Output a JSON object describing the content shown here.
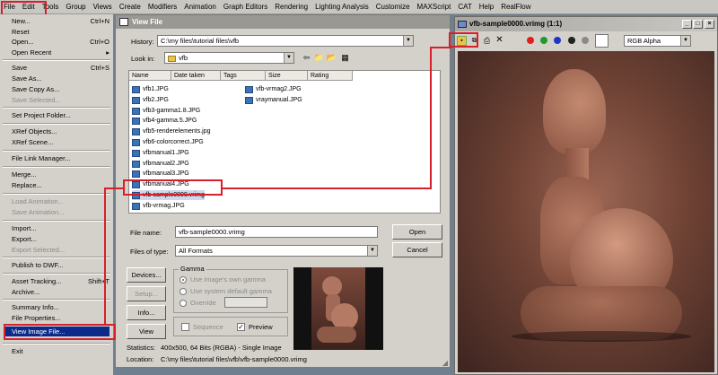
{
  "menubar": {
    "items": [
      "File",
      "Edit",
      "Tools",
      "Group",
      "Views",
      "Create",
      "Modifiers",
      "Animation",
      "Graph Editors",
      "Rendering",
      "Lighting Analysis",
      "Customize",
      "MAXScript",
      "CAT",
      "Help",
      "RealFlow"
    ]
  },
  "file_menu": {
    "items": [
      {
        "label": "New...",
        "shortcut": "Ctrl+N",
        "disabled": false
      },
      {
        "label": "Reset",
        "shortcut": "",
        "disabled": false
      },
      {
        "label": "Open...",
        "shortcut": "Ctrl+O",
        "disabled": false
      },
      {
        "label": "Open Recent",
        "shortcut": "▸",
        "disabled": false
      },
      {
        "label": "Save",
        "shortcut": "Ctrl+S",
        "disabled": false
      },
      {
        "label": "Save As...",
        "shortcut": "",
        "disabled": false
      },
      {
        "label": "Save Copy As...",
        "shortcut": "",
        "disabled": false
      },
      {
        "label": "Save Selected...",
        "shortcut": "",
        "disabled": true
      },
      {
        "label": "Set Project Folder...",
        "shortcut": "",
        "disabled": false
      },
      {
        "label": "XRef Objects...",
        "shortcut": "",
        "disabled": false
      },
      {
        "label": "XRef Scene...",
        "shortcut": "",
        "disabled": false
      },
      {
        "label": "File Link Manager...",
        "shortcut": "",
        "disabled": false
      },
      {
        "label": "Merge...",
        "shortcut": "",
        "disabled": false
      },
      {
        "label": "Replace...",
        "shortcut": "",
        "disabled": false
      },
      {
        "label": "Load Animation...",
        "shortcut": "",
        "disabled": true
      },
      {
        "label": "Save Animation...",
        "shortcut": "",
        "disabled": true
      },
      {
        "label": "Import...",
        "shortcut": "",
        "disabled": false
      },
      {
        "label": "Export...",
        "shortcut": "",
        "disabled": false
      },
      {
        "label": "Export Selected...",
        "shortcut": "",
        "disabled": true
      },
      {
        "label": "Publish to DWF...",
        "shortcut": "",
        "disabled": false
      },
      {
        "label": "Asset Tracking...",
        "shortcut": "Shift+T",
        "disabled": false
      },
      {
        "label": "Archive...",
        "shortcut": "",
        "disabled": false
      },
      {
        "label": "Summary Info...",
        "shortcut": "",
        "disabled": false
      },
      {
        "label": "File Properties...",
        "shortcut": "",
        "disabled": false
      },
      {
        "label": "View Image File...",
        "shortcut": "",
        "disabled": false,
        "selected": true
      },
      {
        "label": "Exit",
        "shortcut": "",
        "disabled": false
      }
    ]
  },
  "dialog": {
    "title": "View File",
    "history_label": "History:",
    "history_value": "C:\\my files\\tutorial files\\vfb",
    "lookin_label": "Look in:",
    "lookin_value": "vfb",
    "columns": [
      "Name",
      "Date taken",
      "Tags",
      "Size",
      "Rating"
    ],
    "files_col1": [
      "vfb1.JPG",
      "vfb2.JPG",
      "vfb3-gamma1.8.JPG",
      "vfb4-gamma.5.JPG",
      "vfb5-renderelements.jpg",
      "vfb6-colorcorrect.JPG",
      "vfbmanual1.JPG",
      "vfbmanual2.JPG",
      "vfbmanual3.JPG",
      "vfbmanual4.JPG",
      "vfb-sample0000.vrimg",
      "vfb-vrmag.JPG"
    ],
    "files_col2": [
      "vfb-vrmag2.JPG",
      "vraymanual.JPG"
    ],
    "selected_file": "vfb-sample0000.vrimg",
    "filename_label": "File name:",
    "filename_value": "vfb-sample0000.vrimg",
    "filetype_label": "Files of type:",
    "filetype_value": "All Formats",
    "open_label": "Open",
    "cancel_label": "Cancel",
    "devices_label": "Devices...",
    "setup_label": "Setup...",
    "info_label": "Info...",
    "view_label": "View",
    "gamma_title": "Gamma",
    "gamma_own": "Use image's own gamma",
    "gamma_system": "Use system default gamma",
    "gamma_override": "Override",
    "sequence_label": "Sequence",
    "preview_label": "Preview",
    "statistics_label": "Statistics:",
    "statistics_value": "400x500, 64 Bits (RGBA) - Single Image",
    "location_label": "Location:",
    "location_value": "C:\\my files\\tutorial files\\vfb\\vfb-sample0000.vrimg"
  },
  "vfb": {
    "title": "vfb-sample0000.vrimg (1:1)",
    "channel": "RGB Alpha",
    "colors": {
      "red": "#e0201c",
      "green": "#1f9a2e",
      "blue": "#1d36c8",
      "black": "#222222",
      "gray": "#8a8a8a"
    }
  }
}
